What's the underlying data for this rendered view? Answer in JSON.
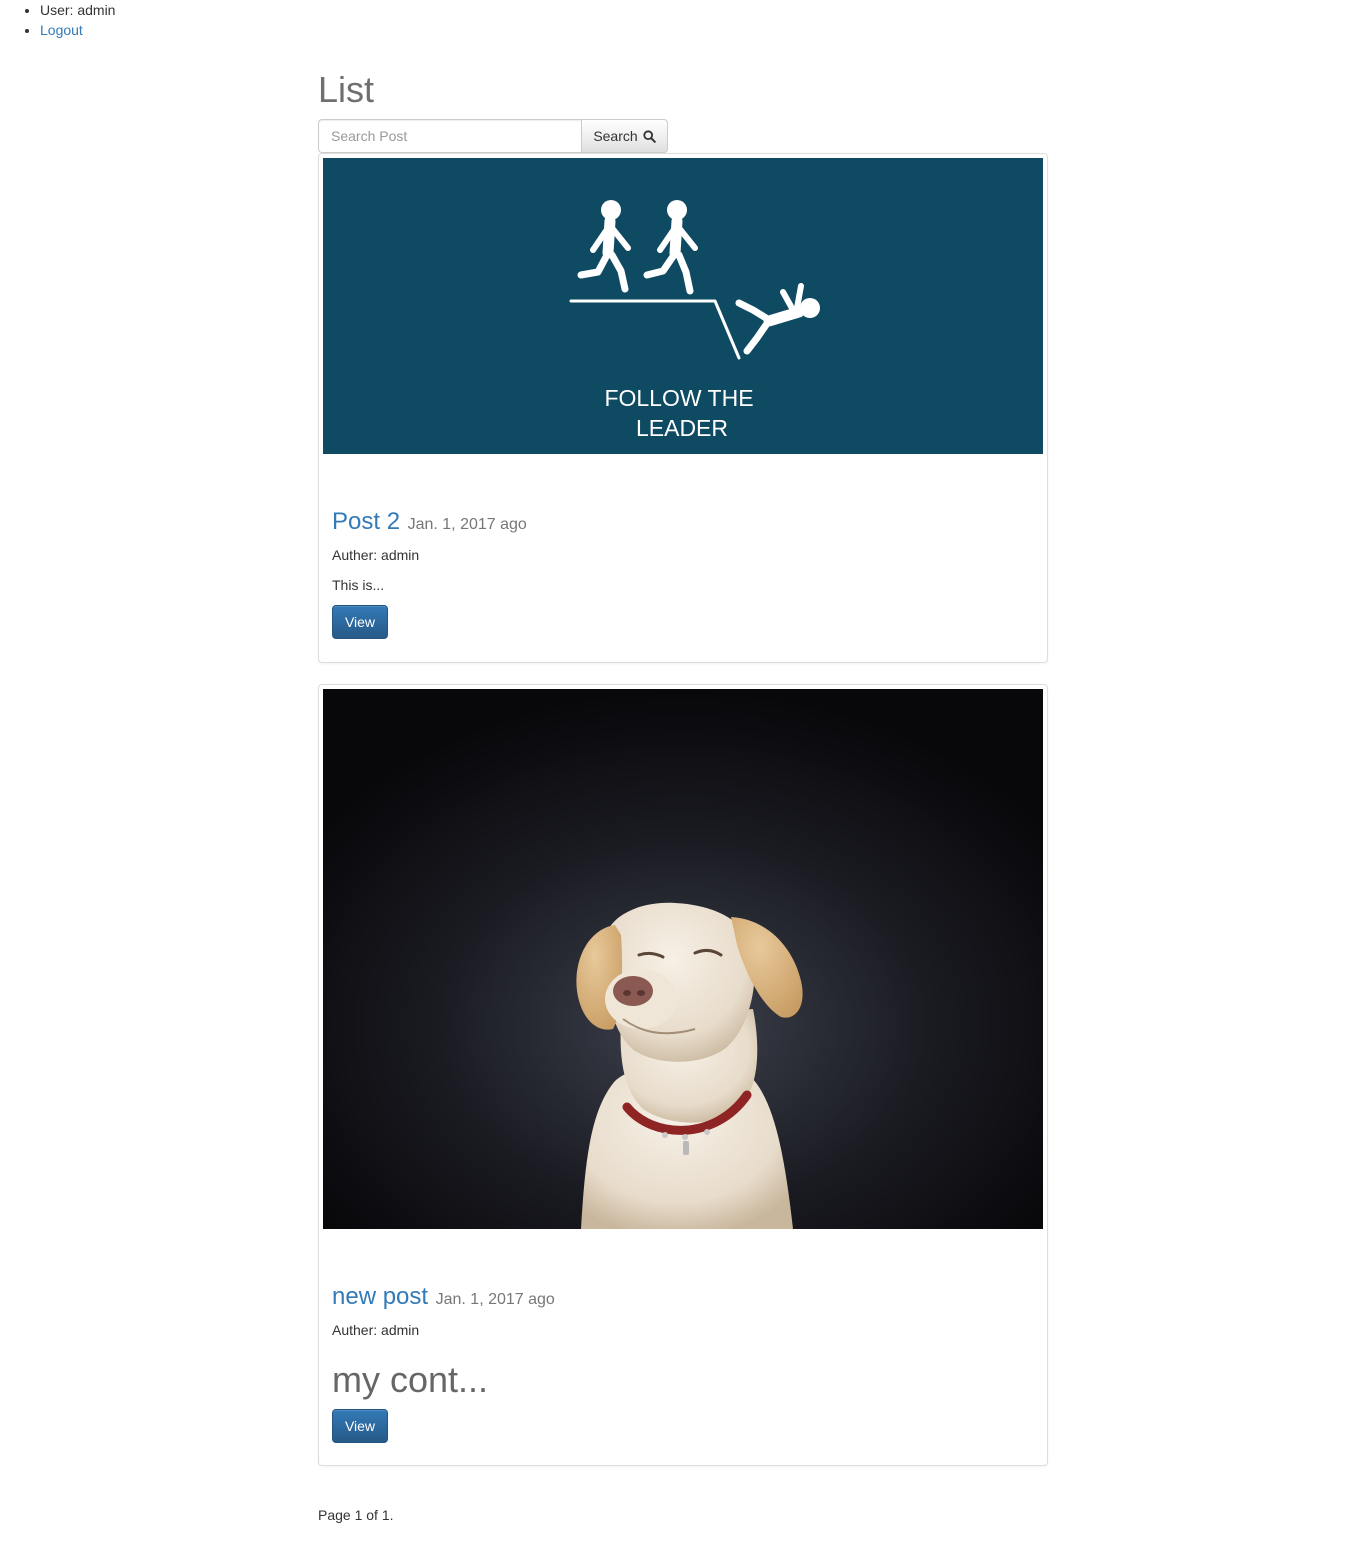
{
  "nav": {
    "user_label": "User: admin",
    "logout_label": "Logout"
  },
  "page": {
    "title": "List"
  },
  "search": {
    "placeholder": "Search Post",
    "value": "",
    "button_label": "Search"
  },
  "posts": [
    {
      "title": "Post 2",
      "date": "Jan. 1, 2017 ago",
      "author": "Auther: admin",
      "excerpt": "This is...",
      "view_label": "View",
      "image": {
        "caption_line1": "FOLLOW THE",
        "caption_line2": "LEADER",
        "bg_color": "#0f4a63"
      }
    },
    {
      "title": "new post",
      "date": "Jan. 1, 2017 ago",
      "author": "Auther: admin",
      "excerpt": "my cont...",
      "view_label": "View",
      "image": {
        "subject": "dog-photo"
      }
    }
  ],
  "pagination": {
    "text": "Page 1 of 1."
  },
  "colors": {
    "link": "#337ab7",
    "primary_button": "#337ab7",
    "muted": "#777777"
  }
}
